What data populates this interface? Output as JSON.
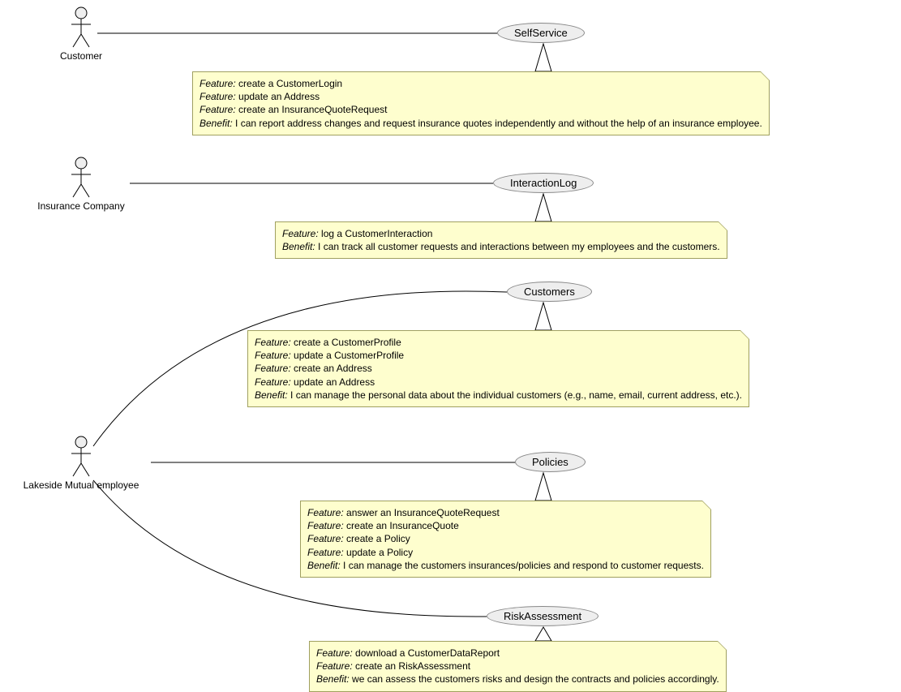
{
  "actors": {
    "customer": {
      "label": "Customer"
    },
    "insuranceCompany": {
      "label": "Insurance Company"
    },
    "lakesideEmployee": {
      "label": "Lakeside Mutual employee"
    }
  },
  "usecases": {
    "selfService": {
      "label": "SelfService"
    },
    "interactionLog": {
      "label": "InteractionLog"
    },
    "customers": {
      "label": "Customers"
    },
    "policies": {
      "label": "Policies"
    },
    "riskAssessment": {
      "label": "RiskAssessment"
    }
  },
  "notes": {
    "selfService": {
      "lines": [
        {
          "k": "Feature:",
          "v": "create a CustomerLogin"
        },
        {
          "k": "Feature:",
          "v": "update an Address"
        },
        {
          "k": "Feature:",
          "v": "create an InsuranceQuoteRequest"
        },
        {
          "k": "Benefit:",
          "v": "I can report address changes and request insurance quotes independently and without the help of an insurance employee."
        }
      ]
    },
    "interactionLog": {
      "lines": [
        {
          "k": "Feature:",
          "v": "log a CustomerInteraction"
        },
        {
          "k": "Benefit:",
          "v": "I can track all customer requests and interactions between my employees and the customers."
        }
      ]
    },
    "customers": {
      "lines": [
        {
          "k": "Feature:",
          "v": "create a CustomerProfile"
        },
        {
          "k": "Feature:",
          "v": "update a CustomerProfile"
        },
        {
          "k": "Feature:",
          "v": "create an Address"
        },
        {
          "k": "Feature:",
          "v": "update an Address"
        },
        {
          "k": "Benefit:",
          "v": "I can manage the personal data about the individual customers (e.g., name, email, current address, etc.)."
        }
      ]
    },
    "policies": {
      "lines": [
        {
          "k": "Feature:",
          "v": "answer an InsuranceQuoteRequest"
        },
        {
          "k": "Feature:",
          "v": "create an InsuranceQuote"
        },
        {
          "k": "Feature:",
          "v": "create a Policy"
        },
        {
          "k": "Feature:",
          "v": "update a Policy"
        },
        {
          "k": "Benefit:",
          "v": "I can manage the customers insurances/policies and respond to customer requests."
        }
      ]
    },
    "riskAssessment": {
      "lines": [
        {
          "k": "Feature:",
          "v": "download a CustomerDataReport"
        },
        {
          "k": "Feature:",
          "v": "create an RiskAssessment"
        },
        {
          "k": "Benefit:",
          "v": "we can assess the customers risks and design the contracts and policies accordingly."
        }
      ]
    }
  }
}
